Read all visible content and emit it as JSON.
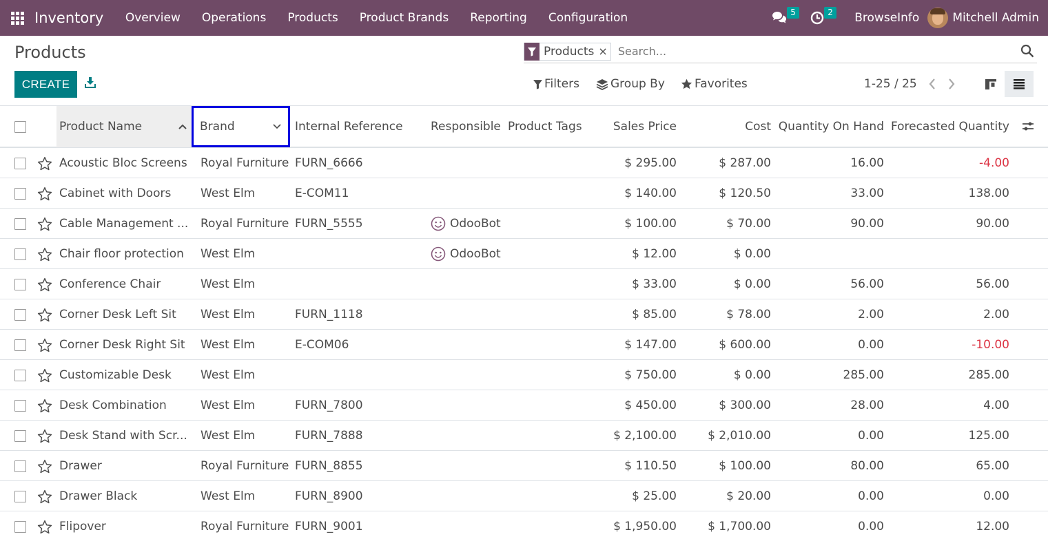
{
  "navbar": {
    "app_name": "Inventory",
    "menu": [
      "Overview",
      "Operations",
      "Products",
      "Product Brands",
      "Reporting",
      "Configuration"
    ],
    "messages_count": "5",
    "activities_count": "2",
    "company": "BrowseInfo",
    "user": "Mitchell Admin",
    "color": "#6f4a66"
  },
  "page": {
    "title": "Products"
  },
  "toolbar": {
    "create_label": "CREATE"
  },
  "search": {
    "facet_label": "Products",
    "facet_close": "×",
    "placeholder": "Search..."
  },
  "filters": {
    "filters_label": "Filters",
    "groupby_label": "Group By",
    "favorites_label": "Favorites"
  },
  "pager": {
    "value": "1-25 / 25"
  },
  "table": {
    "headers": {
      "name": "Product Name",
      "brand": "Brand",
      "ref": "Internal Reference",
      "responsible": "Responsible",
      "tags": "Product Tags",
      "price": "Sales Price",
      "cost": "Cost",
      "qty": "Quantity On Hand",
      "forecast": "Forecasted Quantity"
    },
    "rows": [
      {
        "name": "Acoustic Bloc Screens",
        "brand": "Royal Furniture",
        "ref": "FURN_6666",
        "responsible": "",
        "price": "$ 295.00",
        "cost": "$ 287.00",
        "qty": "16.00",
        "forecast": "-4.00",
        "neg": true
      },
      {
        "name": "Cabinet with Doors",
        "brand": "West Elm",
        "ref": "E-COM11",
        "responsible": "",
        "price": "$ 140.00",
        "cost": "$ 120.50",
        "qty": "33.00",
        "forecast": "138.00",
        "neg": false
      },
      {
        "name": "Cable Management ...",
        "brand": "Royal Furniture",
        "ref": "FURN_5555",
        "responsible": "OdooBot",
        "price": "$ 100.00",
        "cost": "$ 70.00",
        "qty": "90.00",
        "forecast": "90.00",
        "neg": false
      },
      {
        "name": "Chair floor protection",
        "brand": "West Elm",
        "ref": "",
        "responsible": "OdooBot",
        "price": "$ 12.00",
        "cost": "$ 0.00",
        "qty": "",
        "forecast": "",
        "neg": false
      },
      {
        "name": "Conference Chair",
        "brand": "West Elm",
        "ref": "",
        "responsible": "",
        "price": "$ 33.00",
        "cost": "$ 0.00",
        "qty": "56.00",
        "forecast": "56.00",
        "neg": false
      },
      {
        "name": "Corner Desk Left Sit",
        "brand": "West Elm",
        "ref": "FURN_1118",
        "responsible": "",
        "price": "$ 85.00",
        "cost": "$ 78.00",
        "qty": "2.00",
        "forecast": "2.00",
        "neg": false
      },
      {
        "name": "Corner Desk Right Sit",
        "brand": "West Elm",
        "ref": "E-COM06",
        "responsible": "",
        "price": "$ 147.00",
        "cost": "$ 600.00",
        "qty": "0.00",
        "forecast": "-10.00",
        "neg": true
      },
      {
        "name": "Customizable Desk",
        "brand": "West Elm",
        "ref": "",
        "responsible": "",
        "price": "$ 750.00",
        "cost": "$ 0.00",
        "qty": "285.00",
        "forecast": "285.00",
        "neg": false
      },
      {
        "name": "Desk Combination",
        "brand": "West Elm",
        "ref": "FURN_7800",
        "responsible": "",
        "price": "$ 450.00",
        "cost": "$ 300.00",
        "qty": "28.00",
        "forecast": "4.00",
        "neg": false
      },
      {
        "name": "Desk Stand with Scr...",
        "brand": "West Elm",
        "ref": "FURN_7888",
        "responsible": "",
        "price": "$ 2,100.00",
        "cost": "$ 2,010.00",
        "qty": "0.00",
        "forecast": "125.00",
        "neg": false
      },
      {
        "name": "Drawer",
        "brand": "Royal Furniture",
        "ref": "FURN_8855",
        "responsible": "",
        "price": "$ 110.50",
        "cost": "$ 100.00",
        "qty": "80.00",
        "forecast": "65.00",
        "neg": false
      },
      {
        "name": "Drawer Black",
        "brand": "West Elm",
        "ref": "FURN_8900",
        "responsible": "",
        "price": "$ 25.00",
        "cost": "$ 20.00",
        "qty": "0.00",
        "forecast": "0.00",
        "neg": false
      },
      {
        "name": "Flipover",
        "brand": "Royal Furniture",
        "ref": "FURN_9001",
        "responsible": "",
        "price": "$ 1,950.00",
        "cost": "$ 1,700.00",
        "qty": "0.00",
        "forecast": "12.00",
        "neg": false
      }
    ]
  },
  "colors": {
    "primary": "#017e84",
    "negative": "#dc3545",
    "badge": "#00a09d"
  }
}
